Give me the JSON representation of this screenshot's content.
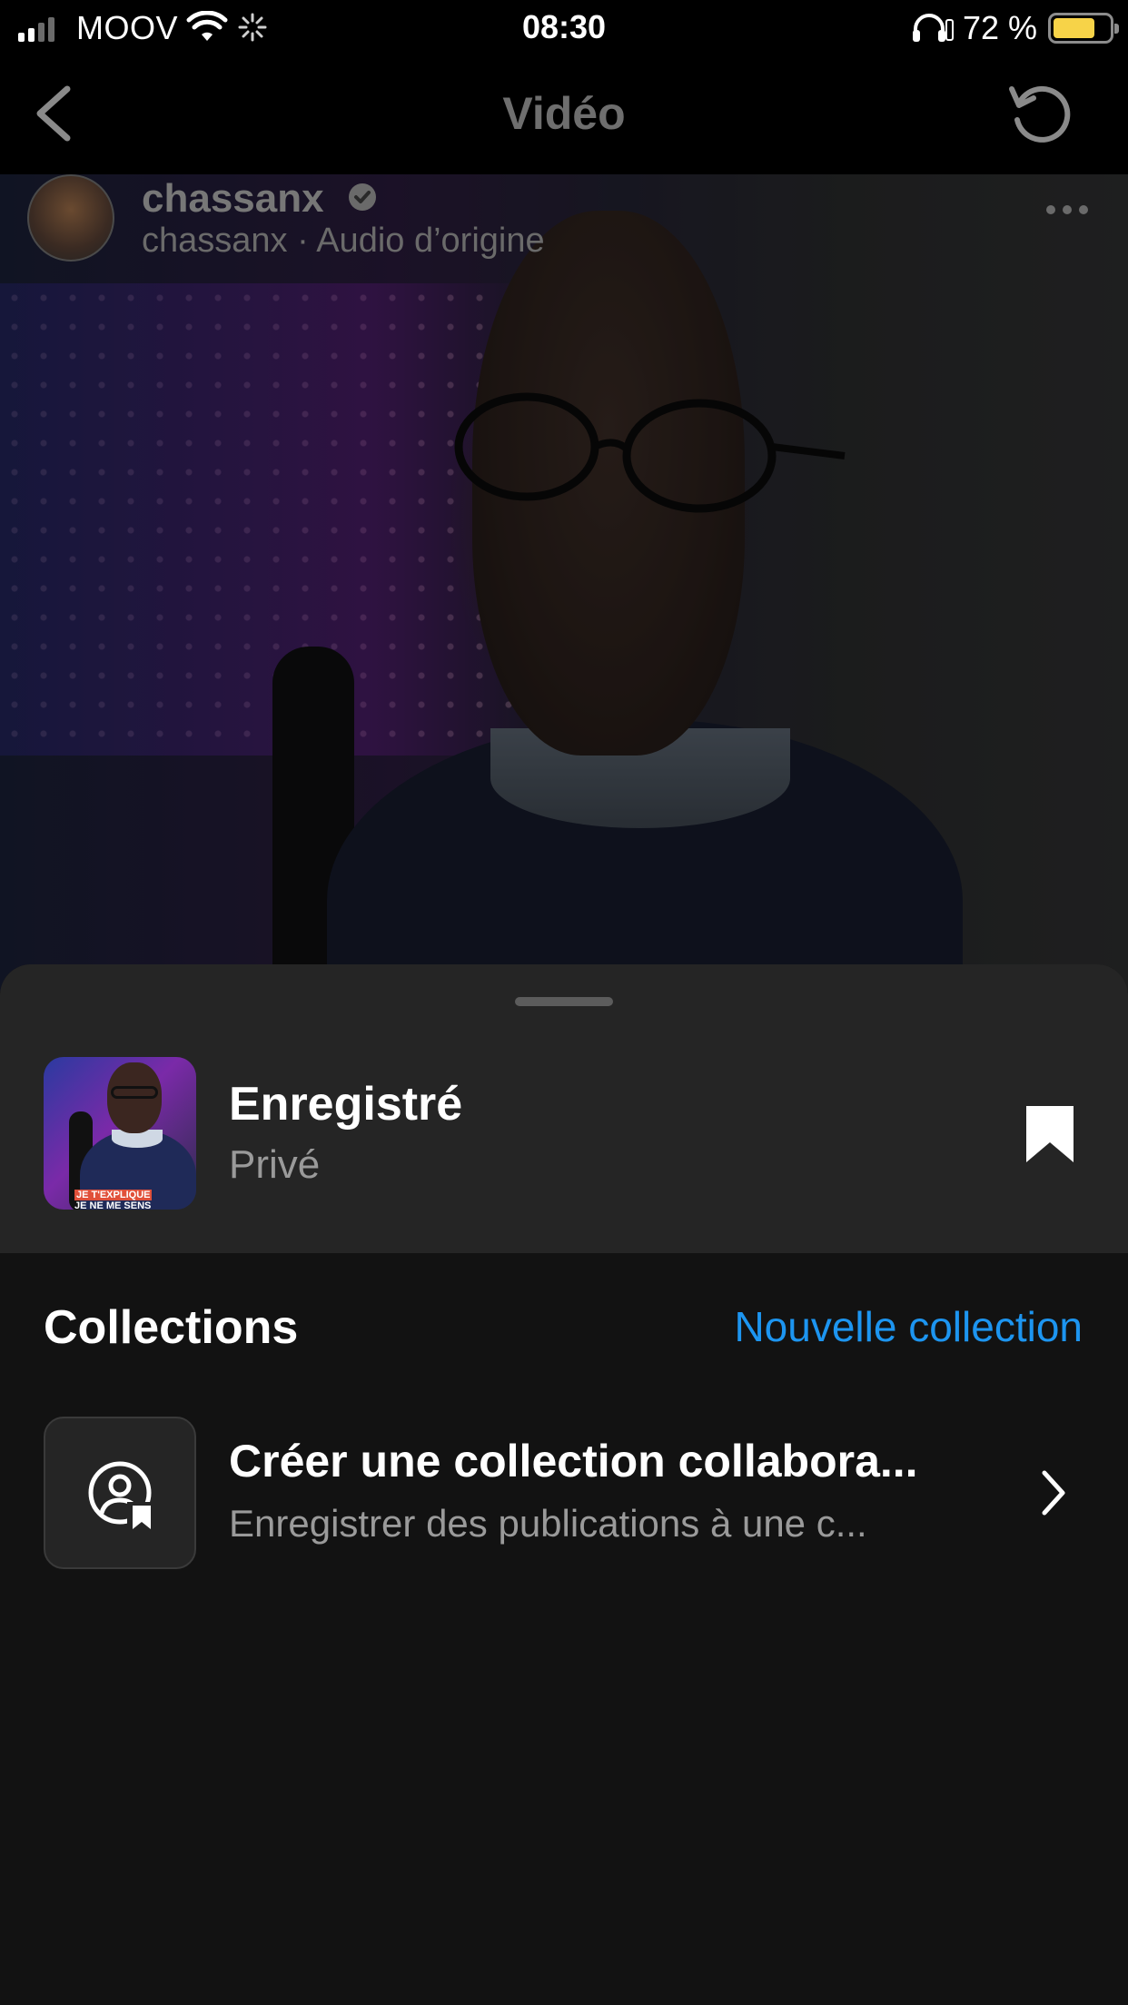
{
  "status_bar": {
    "carrier": "MOOV",
    "time": "08:30",
    "battery_percent": "72 %",
    "battery_level": 0.72
  },
  "nav": {
    "title": "Vidéo"
  },
  "post": {
    "username": "chassanx",
    "audio": "chassanx · Audio d’origine"
  },
  "sheet": {
    "saved_title": "Enregistré",
    "saved_subtitle": "Privé",
    "collections_title": "Collections",
    "new_collection_label": "Nouvelle collection",
    "thumb_caption_line1": "JE T'EXPLIQUE",
    "thumb_caption_line2": "JE NE ME SENS",
    "collab": {
      "title": "Créer une collection collabora...",
      "subtitle": "Enregistrer des publications à une c..."
    }
  },
  "colors": {
    "accent_link": "#1d95f0",
    "sheet_bg": "#121212",
    "sheet_header_bg": "#252525",
    "battery_fill": "#f7d348"
  }
}
